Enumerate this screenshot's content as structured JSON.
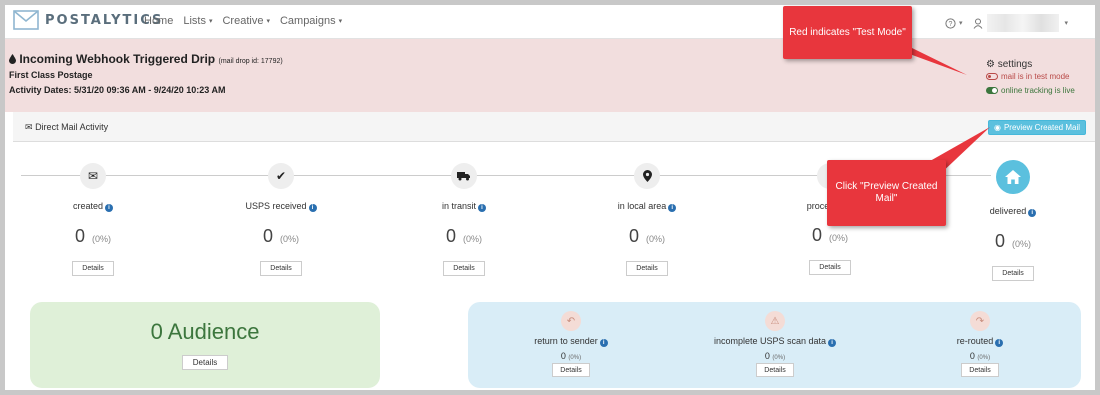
{
  "navbar": {
    "brand": "POSTALYTICS",
    "items": [
      {
        "label": "Home"
      },
      {
        "label": "Lists",
        "caret": "▾"
      },
      {
        "label": "Creative",
        "caret": "▾"
      },
      {
        "label": "Campaigns",
        "caret": "▾"
      }
    ],
    "help_glyph": "?",
    "help_caret": "▾",
    "user_caret": "▾"
  },
  "campaign": {
    "title": "Incoming Webhook Triggered Drip",
    "drop_id": "(mail drop id: 17792)",
    "postage": "First Class Postage",
    "dates": "Activity Dates: 5/31/20 09:36 AM - 9/24/20 10:23 AM",
    "settings_label": "settings",
    "test_mode_label": "mail is in test mode",
    "tracking_label": "online tracking is live"
  },
  "panel": {
    "title": "Direct Mail Activity",
    "preview_button": "Preview Created Mail"
  },
  "steps": [
    {
      "label": "created",
      "count": "0",
      "pct": "(0%)",
      "details": "Details",
      "icon": "envelope-icon",
      "glyph": "✉"
    },
    {
      "label": "USPS received",
      "count": "0",
      "pct": "(0%)",
      "details": "Details",
      "icon": "check-icon",
      "glyph": "✔"
    },
    {
      "label": "in transit",
      "count": "0",
      "pct": "(0%)",
      "details": "Details",
      "icon": "truck-icon",
      "glyph": "⛟"
    },
    {
      "label": "in local area",
      "count": "0",
      "pct": "(0%)",
      "details": "Details",
      "icon": "map-marker-icon",
      "glyph": "⚲"
    },
    {
      "label": "processed f",
      "count": "0",
      "pct": "(0%)",
      "details": "Details",
      "icon": "share-icon",
      "glyph": "<"
    },
    {
      "label": "delivered",
      "count": "0",
      "pct": "(0%)",
      "details": "Details",
      "icon": "home-icon",
      "glyph": "⌂"
    }
  ],
  "audience": {
    "label": "0 Audience",
    "details": "Details"
  },
  "issues": [
    {
      "label": "return to sender",
      "count": "0",
      "pct": "(0%)",
      "details": "Details",
      "icon": "reply-icon",
      "glyph": "↶"
    },
    {
      "label": "incomplete USPS scan data",
      "count": "0",
      "pct": "(0%)",
      "details": "Details",
      "icon": "warning-icon",
      "glyph": "⚠"
    },
    {
      "label": "re-routed",
      "count": "0",
      "pct": "(0%)",
      "details": "Details",
      "icon": "forward-icon",
      "glyph": "↷"
    }
  ],
  "info_glyph": "i",
  "callouts": {
    "test_mode": "Red indicates \"Test Mode\"",
    "preview": "Click \"Preview Created Mail\""
  },
  "colors": {
    "banner": "#f2dede",
    "callout": "#e8363d",
    "preview_button": "#5bc0de",
    "audience": "#dff0d8",
    "issues": "#d9edf7"
  }
}
